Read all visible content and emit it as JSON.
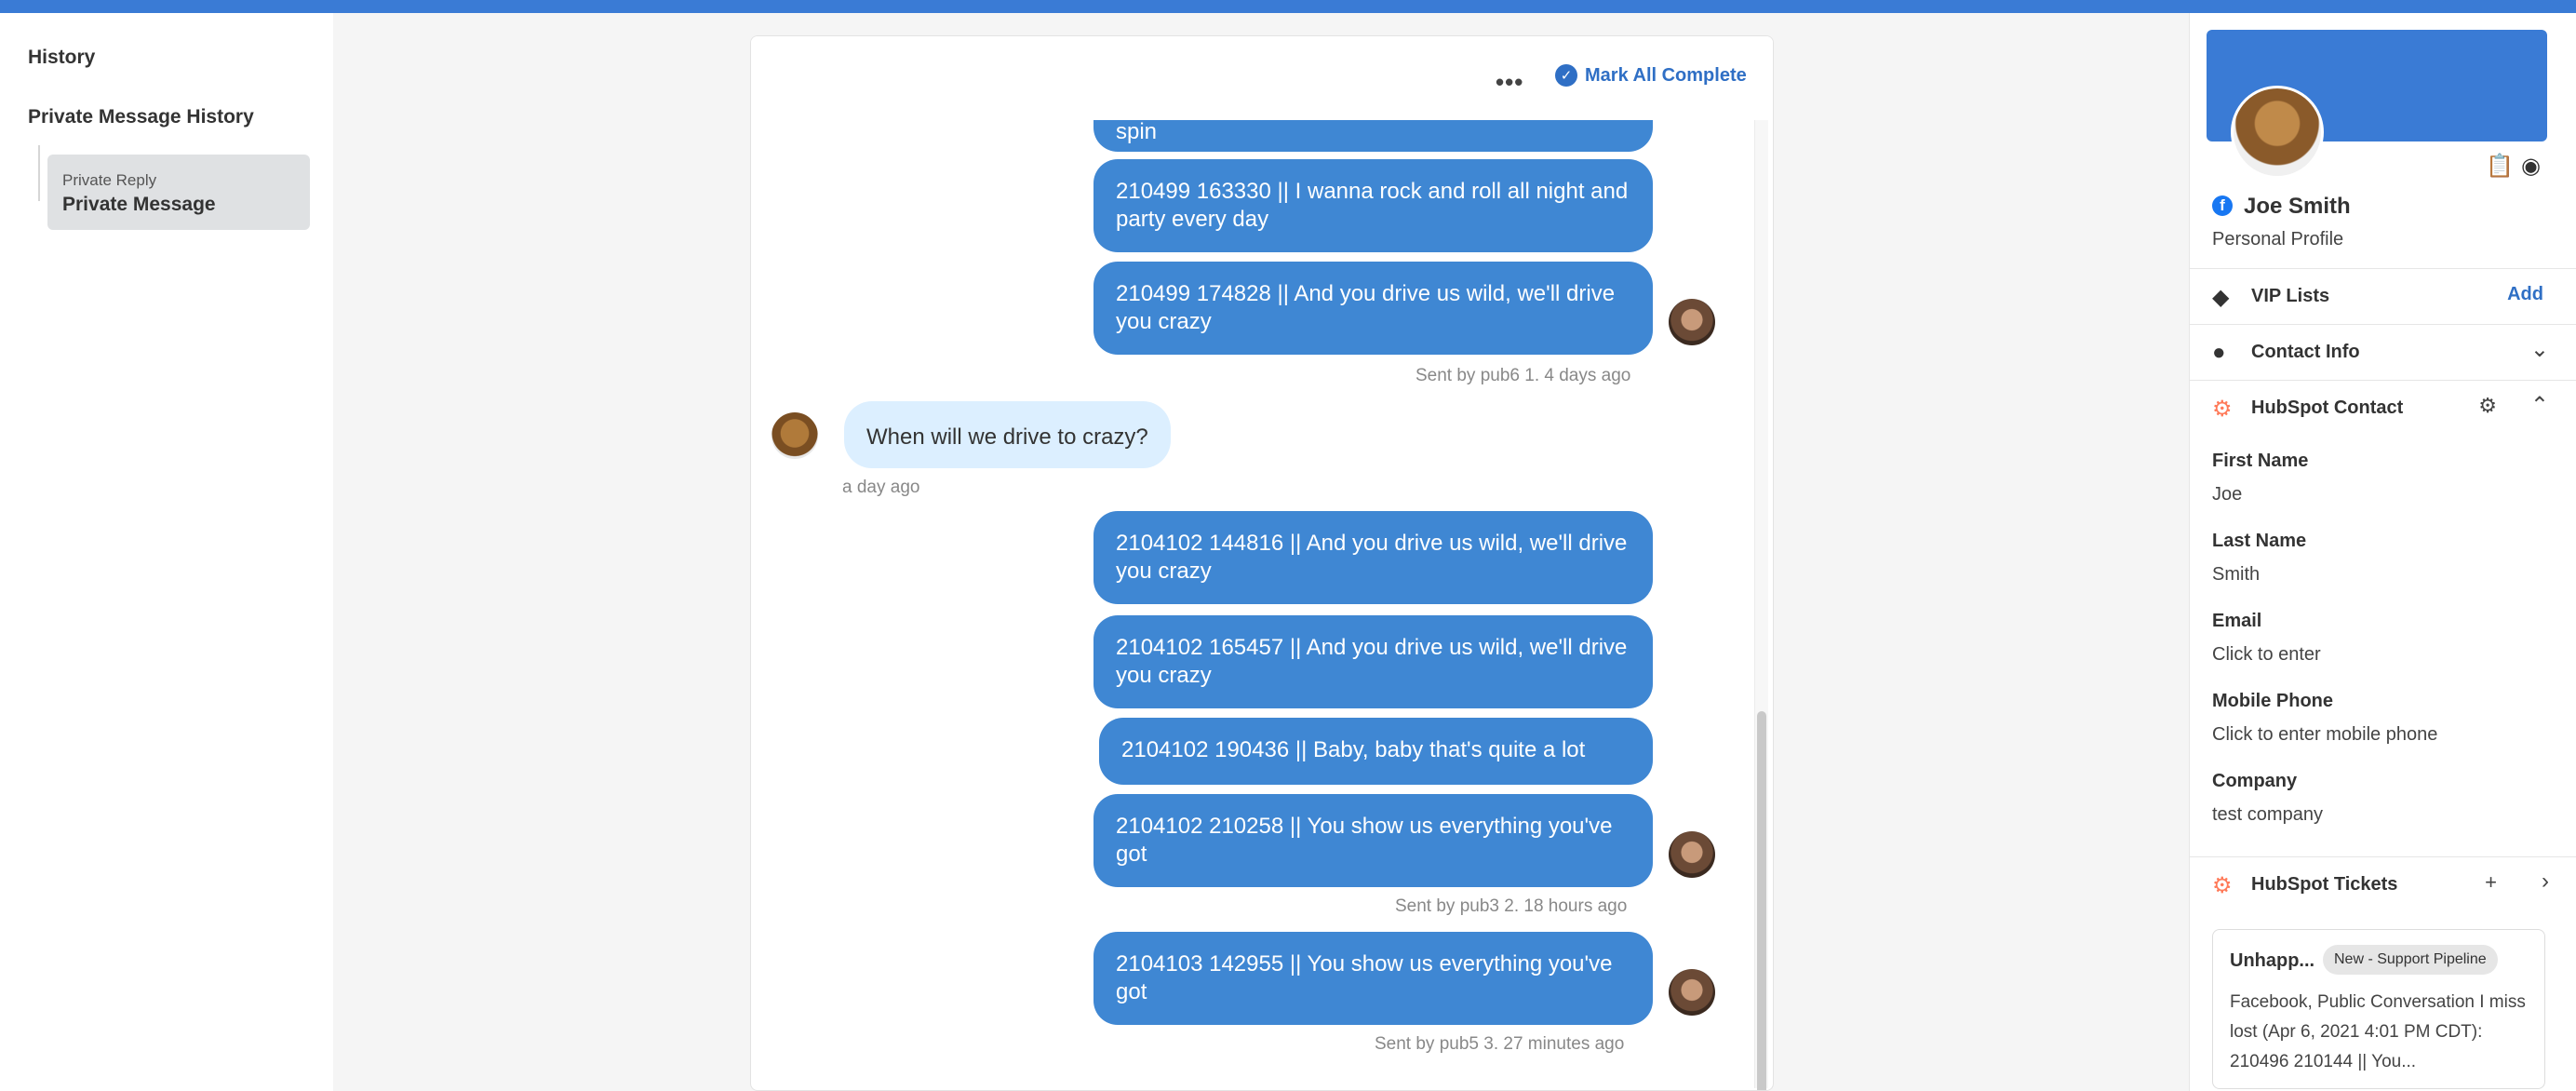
{
  "sidebar": {
    "title": "History",
    "section": "Private Message History",
    "item": {
      "type": "Private Reply",
      "label": "Private Message"
    }
  },
  "conversation": {
    "more_label": "•••",
    "mark_all_label": "Mark All Complete",
    "top_partial": "spin",
    "messages": [
      {
        "id": "m1",
        "text": "210499 163330 || I wanna rock and roll all night and party every day"
      },
      {
        "id": "m2",
        "text": "210499 174828 || And you drive us wild, we'll drive you crazy"
      },
      {
        "id": "m3",
        "text": "2104102 144816 || And you drive us wild, we'll drive you crazy"
      },
      {
        "id": "m4",
        "text": "2104102 165457 || And you drive us wild, we'll drive you crazy"
      },
      {
        "id": "m5",
        "text": "2104102 190436 || Baby, baby that's quite a lot"
      },
      {
        "id": "m6",
        "text": "2104102 210258 || You show us everything you've got"
      },
      {
        "id": "m7",
        "text": "2104103 142955 || You show us everything you've got"
      }
    ],
    "meta1": "Sent by pub6 1. 4 days ago",
    "incoming": {
      "text": "When will we drive to crazy?",
      "time": "a day ago"
    },
    "meta2": "Sent by pub3 2. 18 hours ago",
    "meta3": "Sent by pub5 3. 27 minutes ago"
  },
  "contact": {
    "name": "Joe Smith",
    "profile_type": "Personal Profile",
    "vip_label": "VIP Lists",
    "vip_action": "Add",
    "contact_info_label": "Contact Info",
    "hubspot_contact_label": "HubSpot Contact",
    "fields": [
      {
        "label": "First Name",
        "value": "Joe"
      },
      {
        "label": "Last Name",
        "value": "Smith"
      },
      {
        "label": "Email",
        "value": "Click to enter"
      },
      {
        "label": "Mobile Phone",
        "value": "Click to enter mobile phone"
      },
      {
        "label": "Company",
        "value": "test company"
      }
    ],
    "tickets_label": "HubSpot Tickets",
    "ticket": {
      "title": "Unhapp...",
      "status": "New - Support Pipeline",
      "body": "Facebook, Public Conversation I miss lost (Apr 6, 2021 4:01 PM CDT): 210496 210144 || You..."
    }
  },
  "colors": {
    "accent": "#3a7bd5",
    "bubble": "#3f87d3",
    "incoming": "#dcefff",
    "hubspot": "#ff7a59"
  }
}
